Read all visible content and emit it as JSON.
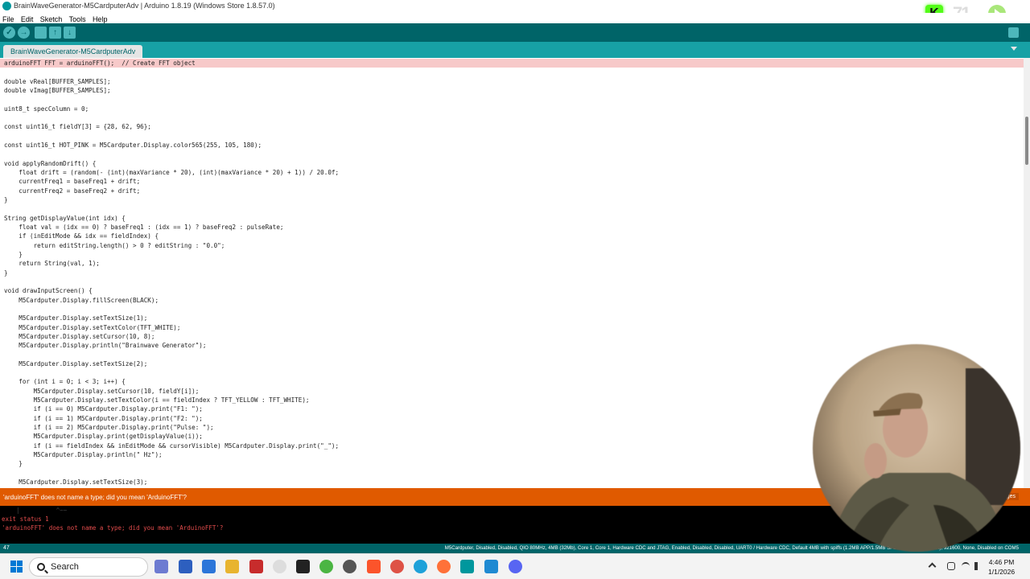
{
  "window": {
    "title": "BrainWaveGenerator-M5CardputerAdv | Arduino 1.8.19 (Windows Store 1.8.57.0)"
  },
  "menu": [
    "File",
    "Edit",
    "Sketch",
    "Tools",
    "Help"
  ],
  "toolbar": {
    "buttons": [
      "verify-icon",
      "upload-icon",
      "new-icon",
      "open-icon",
      "save-icon"
    ],
    "serial_monitor": "serial-monitor-icon"
  },
  "tab": {
    "label": "BrainWaveGenerator-M5CardputerAdv"
  },
  "code": [
    "arduinoFFT FFT = arduinoFFT();  // Create FFT object",
    "",
    "double vReal[BUFFER_SAMPLES];",
    "double vImag[BUFFER_SAMPLES];",
    "",
    "uint8_t specColumn = 0;",
    "",
    "const uint16_t fieldY[3] = {28, 62, 96};",
    "",
    "const uint16_t HOT_PINK = M5Cardputer.Display.color565(255, 105, 180);",
    "",
    "void applyRandomDrift() {",
    "    float drift = (random(- (int)(maxVariance * 20), (int)(maxVariance * 20) + 1)) / 20.0f;",
    "    currentFreq1 = baseFreq1 + drift;",
    "    currentFreq2 = baseFreq2 + drift;",
    "}",
    "",
    "String getDisplayValue(int idx) {",
    "    float val = (idx == 0) ? baseFreq1 : (idx == 1) ? baseFreq2 : pulseRate;",
    "    if (inEditMode && idx == fieldIndex) {",
    "        return editString.length() > 0 ? editString : \"0.0\";",
    "    }",
    "    return String(val, 1);",
    "}",
    "",
    "void drawInputScreen() {",
    "    M5Cardputer.Display.fillScreen(BLACK);",
    "",
    "    M5Cardputer.Display.setTextSize(1);",
    "    M5Cardputer.Display.setTextColor(TFT_WHITE);",
    "    M5Cardputer.Display.setCursor(10, 8);",
    "    M5Cardputer.Display.println(\"Brainwave Generator\");",
    "",
    "    M5Cardputer.Display.setTextSize(2);",
    "",
    "    for (int i = 0; i < 3; i++) {",
    "        M5Cardputer.Display.setCursor(10, fieldY[i]);",
    "        M5Cardputer.Display.setTextColor(i == fieldIndex ? TFT_YELLOW : TFT_WHITE);",
    "        if (i == 0) M5Cardputer.Display.print(\"F1: \");",
    "        if (i == 1) M5Cardputer.Display.print(\"F2: \");",
    "        if (i == 2) M5Cardputer.Display.print(\"Pulse: \");",
    "        M5Cardputer.Display.print(getDisplayValue(i));",
    "        if (i == fieldIndex && inEditMode && cursorVisible) M5Cardputer.Display.print(\"_\");",
    "        M5Cardputer.Display.println(\" Hz\");",
    "    }",
    "",
    "    M5Cardputer.Display.setTextSize(3);"
  ],
  "error_bar": {
    "message": "'arduinoFFT' does not name a type; did you mean 'ArduinoFFT'?",
    "copy_label": "essages"
  },
  "console": [
    "    |          ^~~",
    "exit status 1",
    "'arduinoFFT' does not name a type; did you mean 'ArduinoFFT'?"
  ],
  "status": {
    "line_number": "47",
    "board": "M5Cardputer, Disabled, Disabled, QIO 80MHz, 4MB (32Mb), Core 1, Core 1, Hardware CDC and JTAG, Enabled, Disabled, Disabled, UART0 / Hardware CDC, Default 4MB with spiffs (1.2MB APP/1.5MB SPIFFS), 240MHz (WiFi), 921600, None, Disabled on COM5"
  },
  "taskbar": {
    "search_label": "Search",
    "time": "4:46 PM",
    "date": "1/1/2026"
  },
  "colors": {
    "toolbar": "#006468",
    "tabbar": "#17a1a5",
    "error_bar": "#e05a00",
    "error_line": "#f7c9c9"
  }
}
